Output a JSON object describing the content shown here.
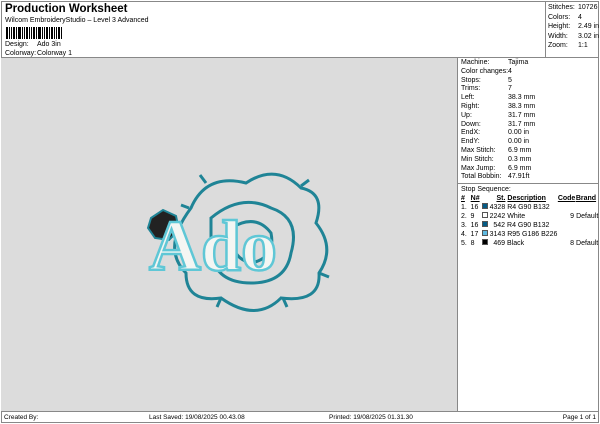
{
  "header": {
    "title": "Production Worksheet",
    "subtitle": "Wilcom EmbroideryStudio – Level 3 Advanced",
    "design_label": "Design:",
    "design": "Ado 3in",
    "colorway_label": "Colorway:",
    "colorway": "Colorway 1"
  },
  "stats": [
    {
      "k": "Stitches:",
      "v": "10726"
    },
    {
      "k": "Colors:",
      "v": "4"
    },
    {
      "k": "Height:",
      "v": "2.49 in"
    },
    {
      "k": "Width:",
      "v": "3.02 in"
    },
    {
      "k": "Zoom:",
      "v": "1:1"
    }
  ],
  "info": [
    {
      "k": "Machine:",
      "v": "Tajima"
    },
    {
      "k": "Color changes:",
      "v": "4"
    },
    {
      "k": "Stops:",
      "v": "5"
    },
    {
      "k": "Trims:",
      "v": "7"
    },
    {
      "k": "Left:",
      "v": "38.3 mm"
    },
    {
      "k": "Right:",
      "v": "38.3 mm"
    },
    {
      "k": "Up:",
      "v": "31.7 mm"
    },
    {
      "k": "Down:",
      "v": "31.7 mm"
    },
    {
      "k": "EndX:",
      "v": "0.00 in"
    },
    {
      "k": "EndY:",
      "v": "0.00 in"
    },
    {
      "k": "Max Stitch:",
      "v": "6.9 mm"
    },
    {
      "k": "Min Stitch:",
      "v": "0.3 mm"
    },
    {
      "k": "Max Jump:",
      "v": "6.9 mm"
    },
    {
      "k": "Total Bobbin:",
      "v": "47.91ft"
    }
  ],
  "stop_sequence": {
    "title": "Stop Sequence:",
    "headers": [
      "#",
      "N#",
      "St.",
      "Description",
      "Code",
      "Brand"
    ],
    "rows": [
      {
        "n": "1.",
        "needle": "16",
        "color": "#045a84",
        "st": "4328",
        "desc": "R4 G90 B132",
        "code": "",
        "brand": ""
      },
      {
        "n": "2.",
        "needle": "9",
        "color": "#ffffff",
        "st": "2242",
        "desc": "White",
        "code": "9",
        "brand": "Default"
      },
      {
        "n": "3.",
        "needle": "16",
        "color": "#045a84",
        "st": "542",
        "desc": "R4 G90 B132",
        "code": "",
        "brand": ""
      },
      {
        "n": "4.",
        "needle": "17",
        "color": "#5fbae2",
        "st": "3143",
        "desc": "R95 G186 B226",
        "code": "",
        "brand": ""
      },
      {
        "n": "5.",
        "needle": "8",
        "color": "#000000",
        "st": "469",
        "desc": "Black",
        "code": "8",
        "brand": "Default"
      }
    ]
  },
  "design_lettering": "Ado",
  "footer": {
    "created": "Created By:",
    "saved": "Last Saved: 19/08/2025 00.43.08",
    "printed": "Printed: 19/08/2025 01.31.30",
    "page": "Page 1 of 1"
  }
}
